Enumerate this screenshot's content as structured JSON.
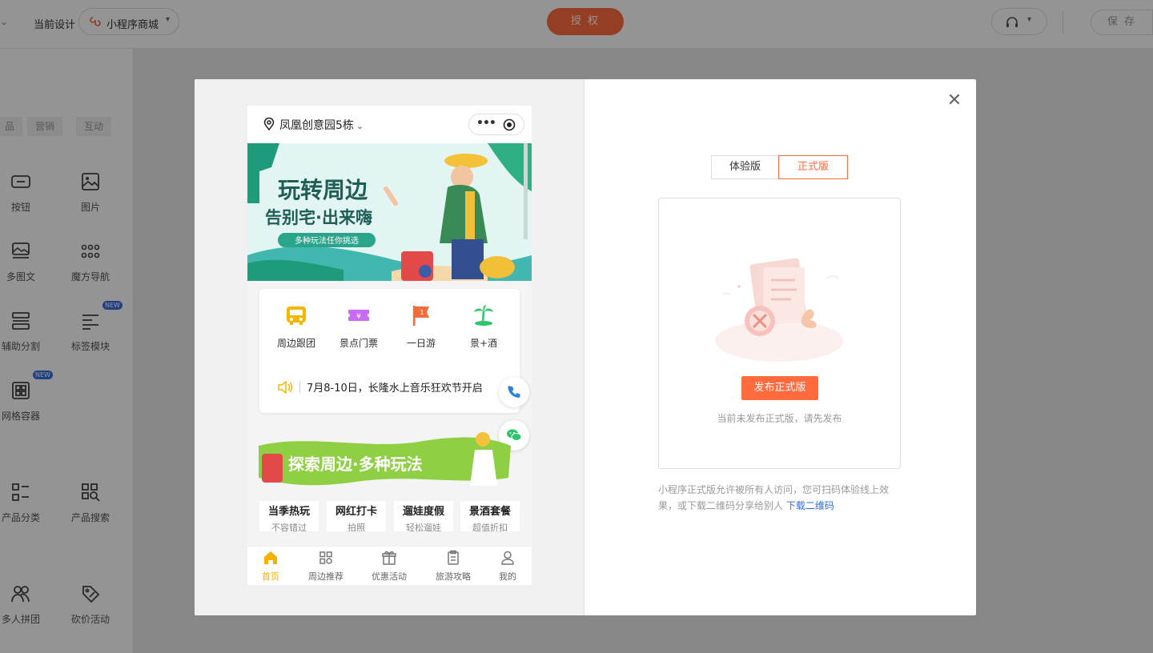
{
  "topbar": {
    "current_design_label": "当前设计",
    "design_name": "小程序商城",
    "authorize_label": "授 权",
    "save_label": "保 存"
  },
  "sidebar": {
    "tabs": [
      "品",
      "营销",
      "互动"
    ],
    "components": [
      {
        "label": "按钮",
        "icon": "button-icon"
      },
      {
        "label": "图片",
        "icon": "image-icon"
      },
      {
        "label": "多图文",
        "icon": "multi-image-text-icon"
      },
      {
        "label": "魔方导航",
        "icon": "cube-nav-icon"
      },
      {
        "label": "辅助分割",
        "icon": "divider-icon"
      },
      {
        "label": "标签模块",
        "icon": "tag-module-icon",
        "badge": "NEW"
      },
      {
        "label": "网格容器",
        "icon": "grid-container-icon",
        "badge": "NEW"
      },
      {
        "label": "产品分类",
        "icon": "product-category-icon"
      },
      {
        "label": "产品搜索",
        "icon": "product-search-icon"
      },
      {
        "label": "多人拼团",
        "icon": "group-buy-icon"
      },
      {
        "label": "砍价活动",
        "icon": "bargain-icon"
      }
    ]
  },
  "phone": {
    "location": "凤凰创意园5栋",
    "banner": {
      "title_line1": "玩转周边",
      "title_line2": "告别宅·出来嗨",
      "subtitle": "多种玩法任你挑选"
    },
    "categories": [
      {
        "label": "周边跟团",
        "color": "#f7b500"
      },
      {
        "label": "景点门票",
        "color": "#c86bf5"
      },
      {
        "label": "一日游",
        "color": "#f26b3a"
      },
      {
        "label": "景+酒",
        "color": "#2ec46e"
      }
    ],
    "notice": "7月8-10日，长隆水上音乐狂欢节开启",
    "promo_text": "探索周边·多种玩法",
    "tags": [
      {
        "title": "当季热玩",
        "sub": "不容错过"
      },
      {
        "title": "网红打卡",
        "sub": "拍照"
      },
      {
        "title": "遛娃度假",
        "sub": "轻松遛娃"
      },
      {
        "title": "景酒套餐",
        "sub": "超值折扣"
      }
    ],
    "tabbar": [
      {
        "label": "首页",
        "icon": "home-icon",
        "active": true
      },
      {
        "label": "周边推荐",
        "icon": "grid-icon"
      },
      {
        "label": "优惠活动",
        "icon": "gift-icon"
      },
      {
        "label": "旅游攻略",
        "icon": "clipboard-icon"
      },
      {
        "label": "我的",
        "icon": "user-icon"
      }
    ]
  },
  "dialog": {
    "tab_trial": "体验版",
    "tab_release": "正式版",
    "publish_button": "发布正式版",
    "publish_hint": "当前未发布正式版，请先发布",
    "info_text": "小程序正式版允许被所有人访问，您可扫码体验线上效果，或下载二维码分享给别人",
    "download_link": "下载二维码"
  },
  "colors": {
    "accent": "#ff6b3d",
    "link": "#2d6cdf",
    "tab_active": "#f5b000"
  }
}
